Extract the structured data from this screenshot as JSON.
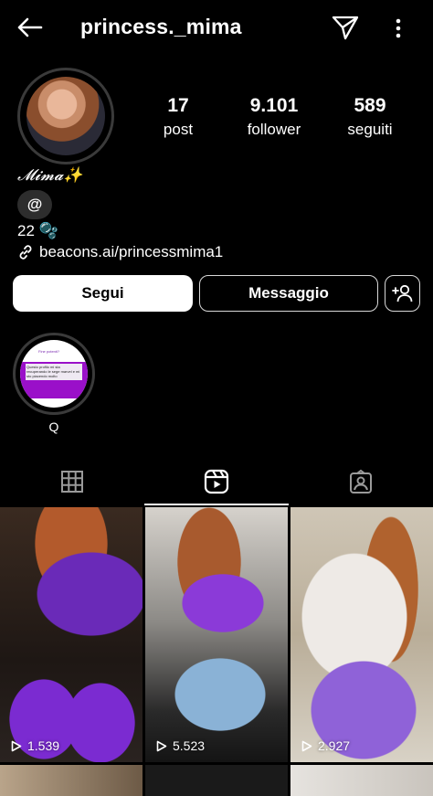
{
  "header": {
    "username": "princess._mima",
    "back_icon": "arrow-left-icon",
    "send_icon": "paper-plane-icon",
    "more_icon": "vertical-dots-icon"
  },
  "profile": {
    "stats": [
      {
        "value": "17",
        "label": "post"
      },
      {
        "value": "9.101",
        "label": "follower"
      },
      {
        "value": "589",
        "label": "seguiti"
      }
    ],
    "display_name": "𝓜𝓲𝓶𝓪✨",
    "threads_badge": "@",
    "bio": "22 🫧",
    "link": "beacons.ai/princessmima1"
  },
  "actions": {
    "follow_label": "Segui",
    "message_label": "Messaggio",
    "add_user_icon": "add-user-icon"
  },
  "highlights": [
    {
      "label": "Q",
      "preview_title": "Fine potenti?",
      "preview_text": "Questo profilo mi sta recuperando le sege marvel e mi sto piacendo molto"
    }
  ],
  "tabs": [
    {
      "icon": "grid-icon",
      "active": false
    },
    {
      "icon": "reels-icon",
      "active": true
    },
    {
      "icon": "tagged-icon",
      "active": false
    }
  ],
  "reels": [
    {
      "views": "1.539"
    },
    {
      "views": "5.523"
    },
    {
      "views": "2.927"
    }
  ]
}
